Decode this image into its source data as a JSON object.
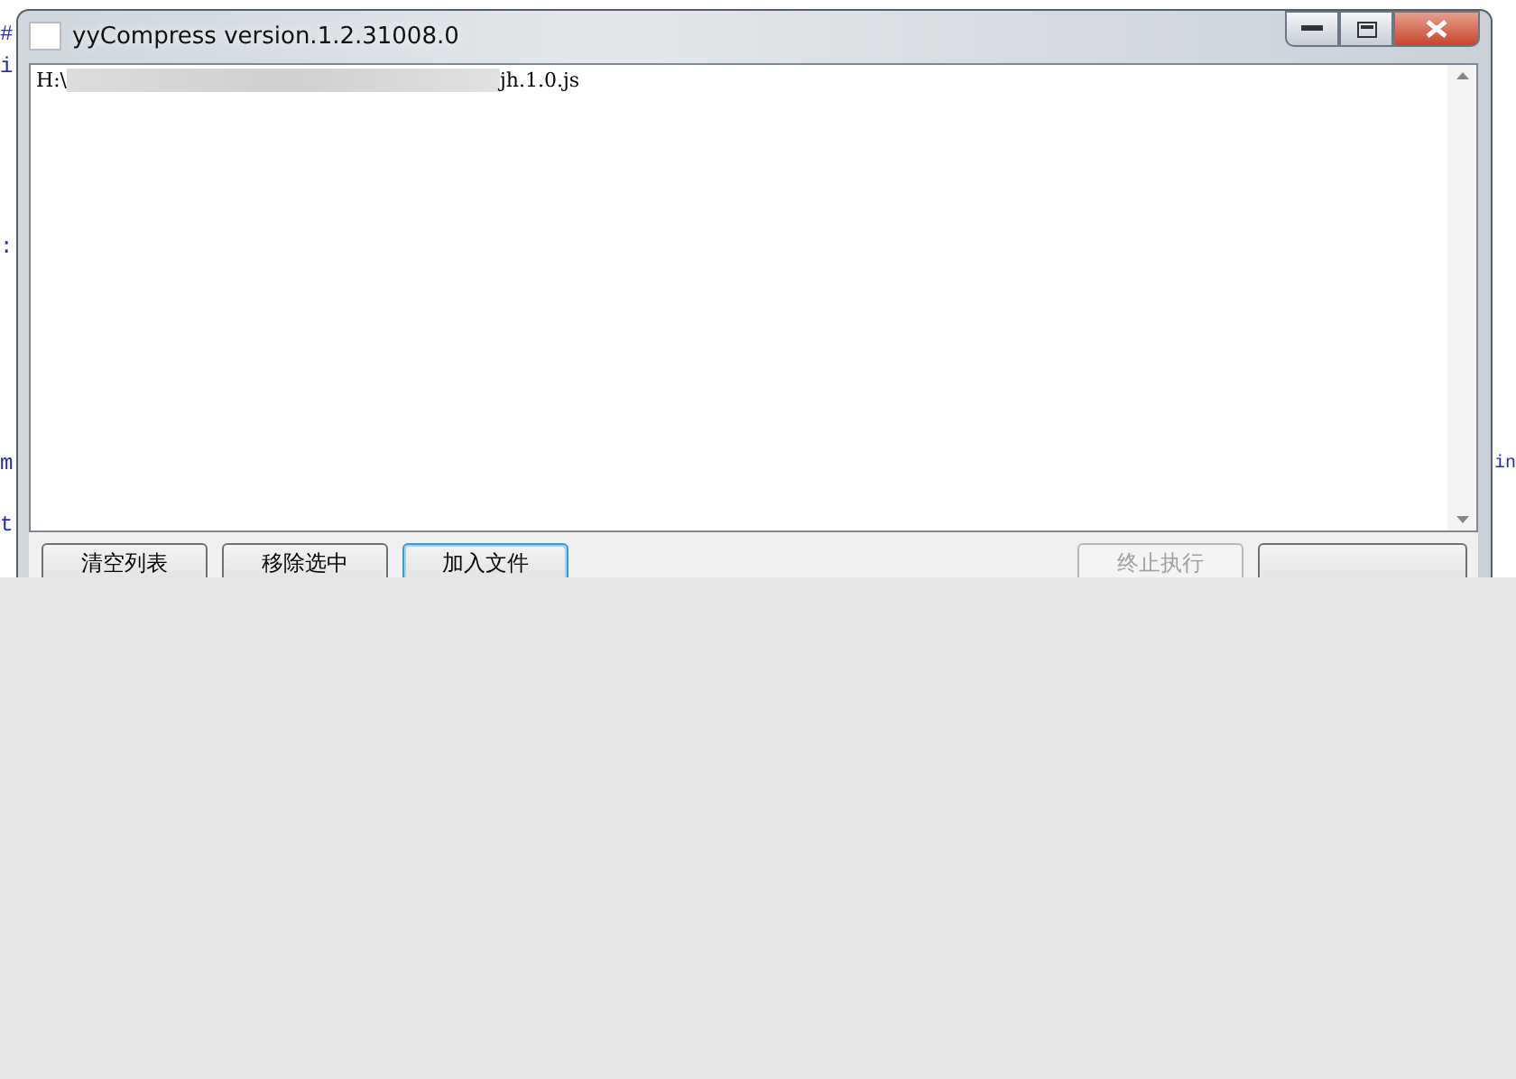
{
  "background_editor": {
    "left_lines": [
      "#",
      "i",
      ":",
      "m",
      "t"
    ],
    "right_lines": [
      "in"
    ]
  },
  "window": {
    "title": "yyCompress version.1.2.31008.0"
  },
  "file_list": {
    "items": [
      {
        "prefix": "H:\\",
        "suffix": "jh.1.0.js"
      }
    ]
  },
  "buttons": [
    {
      "label": "清空列表",
      "focused": false,
      "disabled": false
    },
    {
      "label": "移除选中",
      "focused": false,
      "disabled": false
    },
    {
      "label": "加入文件",
      "focused": true,
      "disabled": false
    },
    {
      "label": "终止执行",
      "focused": false,
      "disabled": true
    }
  ]
}
